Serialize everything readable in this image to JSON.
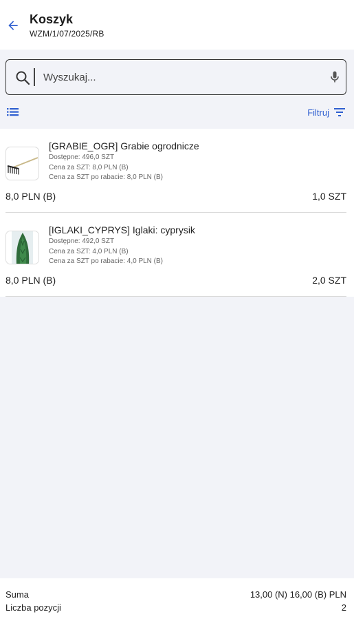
{
  "header": {
    "title": "Koszyk",
    "subtitle": "WZM/1/07/2025/RB",
    "back_icon": "arrow-left-icon",
    "accent_color": "#2f5fd0"
  },
  "search": {
    "placeholder": "Wyszukaj...",
    "value": "",
    "search_icon": "search-icon",
    "mic_icon": "microphone-icon"
  },
  "toolbar": {
    "list_icon": "list-icon",
    "filter_label": "Filtruj",
    "filter_icon": "filter-icon"
  },
  "items": [
    {
      "name": "[GRABIE_OGR] Grabie ogrodnicze",
      "available": "Dostępne: 496,0 SZT",
      "unit_price": "Cena za SZT: 8,0 PLN (B)",
      "discount_price": "Cena za SZT po rabacie: 8,0 PLN (B)",
      "total": "8,0 PLN (B)",
      "quantity": "1,0 SZT",
      "image": "rake-image"
    },
    {
      "name": "[IGLAKI_CYPRYS] Iglaki: cyprysik",
      "available": "Dostępne: 492,0 SZT",
      "unit_price": "Cena za SZT: 4,0 PLN (B)",
      "discount_price": "Cena za SZT po rabacie: 4,0 PLN (B)",
      "total": "8,0 PLN (B)",
      "quantity": "2,0 SZT",
      "image": "cypress-image"
    }
  ],
  "summary": {
    "sum_label": "Suma",
    "sum_value": "13,00 (N) 16,00 (B) PLN",
    "count_label": "Liczba pozycji",
    "count_value": "2"
  }
}
